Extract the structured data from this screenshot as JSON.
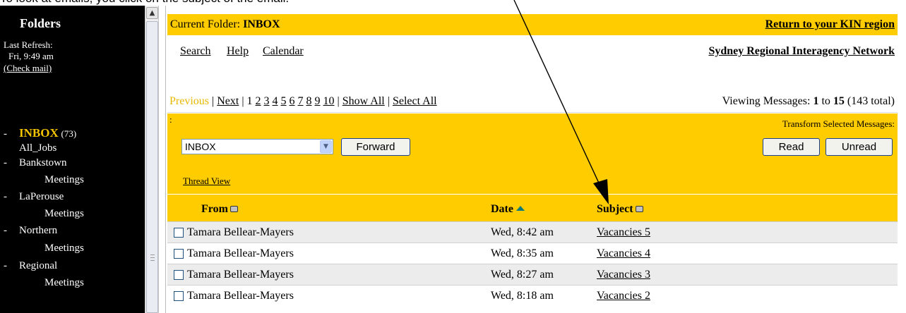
{
  "caption": "To look at emails, you click on the subject of the email.",
  "sidebar": {
    "heading": "Folders",
    "last_refresh_label": "Last Refresh:",
    "last_refresh_time": "Fri, 9:49 am",
    "check_mail": "(Check mail)",
    "folders": [
      {
        "dash": "-",
        "name": "INBOX",
        "count": "(73)"
      },
      {
        "name": "All_Jobs"
      },
      {
        "dash": "-",
        "name": "Bankstown"
      },
      {
        "name": "Meetings"
      },
      {
        "dash": "-",
        "name": "LaPerouse"
      },
      {
        "name": "Meetings"
      },
      {
        "dash": "-",
        "name": "Northern"
      },
      {
        "name": "Meetings"
      },
      {
        "dash": "-",
        "name": "Regional"
      },
      {
        "name": "Meetings"
      }
    ]
  },
  "header": {
    "current_folder_label": "Current Folder:",
    "current_folder": "INBOX",
    "return_link": "Return to your KIN region",
    "nav": [
      "Search",
      "Help",
      "Calendar"
    ],
    "network": "Sydney Regional Interagency Network"
  },
  "paging": {
    "previous": "Previous",
    "sep": "|",
    "next": "Next",
    "pages": [
      "1",
      "2",
      "3",
      "4",
      "5",
      "6",
      "7",
      "8",
      "9",
      "10"
    ],
    "show_all": "Show All",
    "select_all": "Select All",
    "viewing_label": "Viewing Messages:",
    "from": "1",
    "to_label": "to",
    "to": "15",
    "total": "(143 total)"
  },
  "actions": {
    "colon": ":",
    "transform_label": "Transform Selected Messages:",
    "folder_select": "INBOX",
    "forward": "Forward",
    "read": "Read",
    "unread": "Unread",
    "thread_view": "Thread View"
  },
  "columns": {
    "from": "From",
    "date": "Date",
    "subject": "Subject"
  },
  "messages": [
    {
      "from": "Tamara Bellear-Mayers",
      "date": "Wed, 8:42 am",
      "subject": "Vacancies 5"
    },
    {
      "from": "Tamara Bellear-Mayers",
      "date": "Wed, 8:35 am",
      "subject": "Vacancies 4"
    },
    {
      "from": "Tamara Bellear-Mayers",
      "date": "Wed, 8:27 am",
      "subject": "Vacancies 3"
    },
    {
      "from": "Tamara Bellear-Mayers",
      "date": "Wed, 8:18 am",
      "subject": "Vacancies 2"
    }
  ],
  "colors": {
    "band": "#ffcc00",
    "active_folder": "#f5c400",
    "sidebar": "#000000"
  }
}
